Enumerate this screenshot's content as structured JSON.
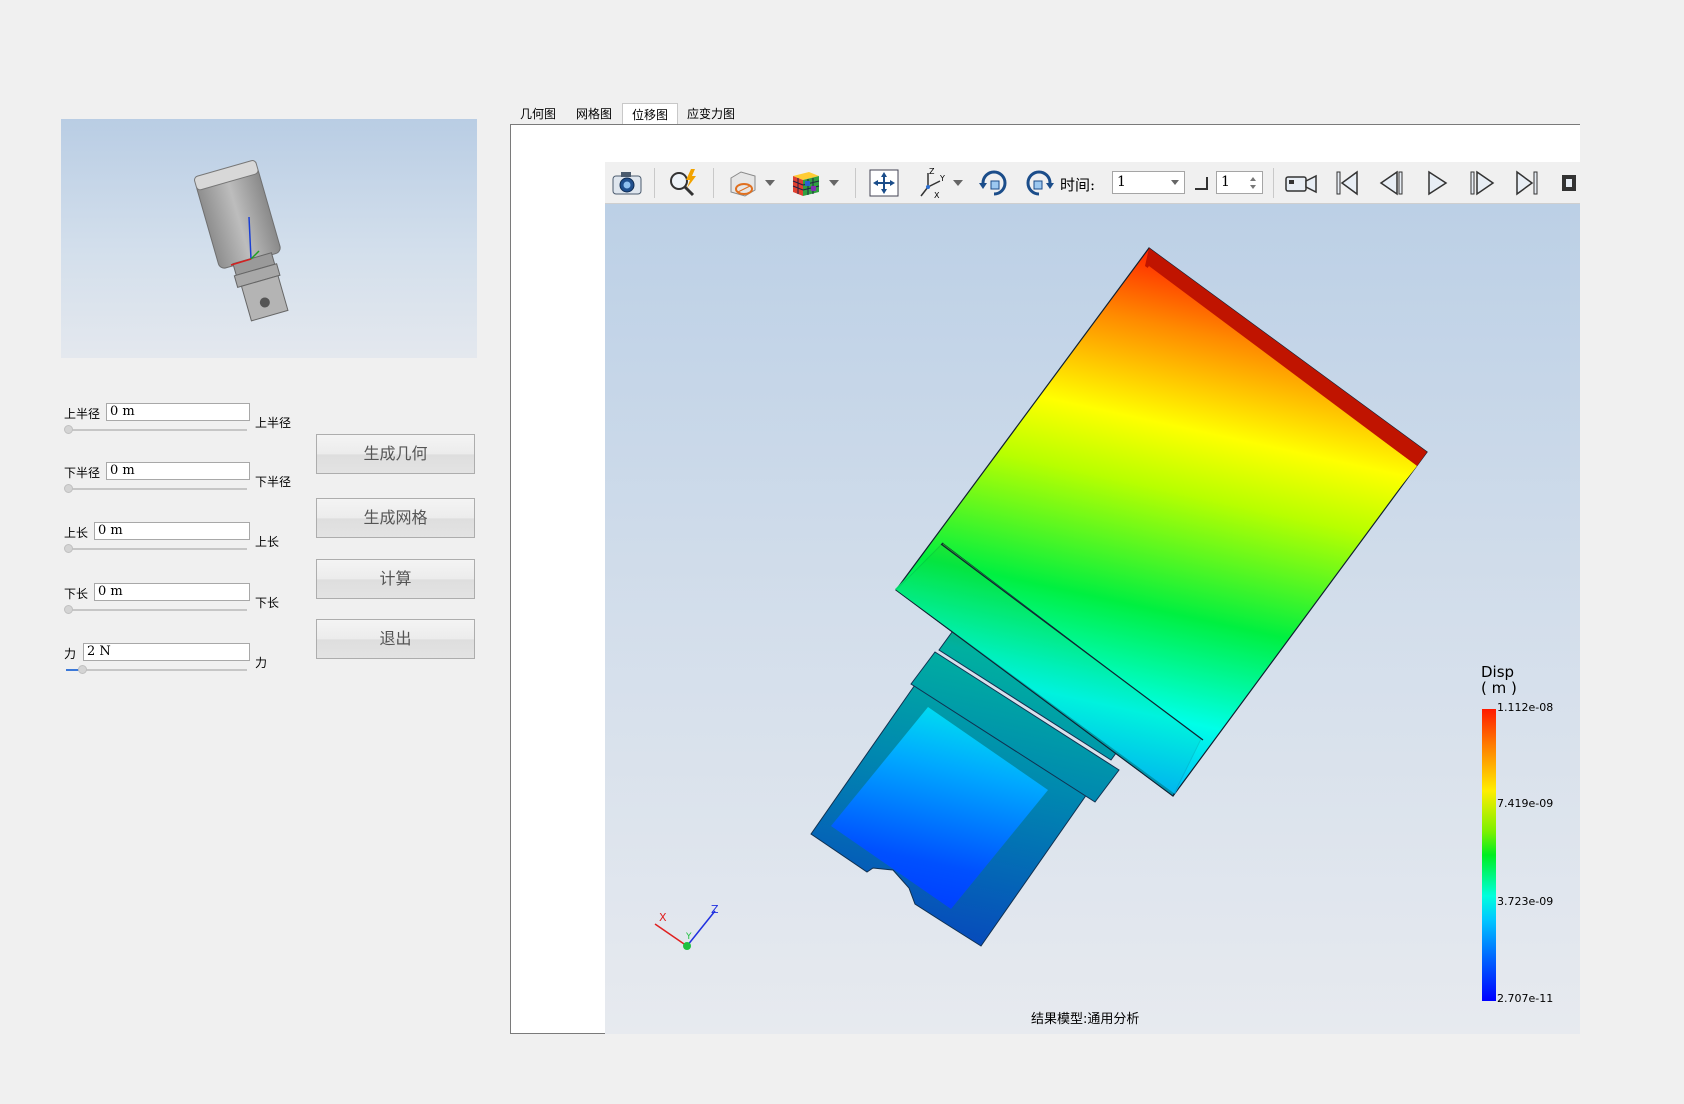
{
  "preview": {
    "name": "geometry-preview"
  },
  "params": [
    {
      "id": "upper-radius",
      "label": "上半径",
      "value": "0 m",
      "unit_label": "上半径",
      "slider": 0
    },
    {
      "id": "lower-radius",
      "label": "下半径",
      "value": "0 m",
      "unit_label": "下半径",
      "slider": 0
    },
    {
      "id": "upper-length",
      "label": "上长",
      "value": "0 m",
      "unit_label": "上长",
      "slider": 0
    },
    {
      "id": "lower-length",
      "label": "下长",
      "value": "0 m",
      "unit_label": "下长",
      "slider": 0
    },
    {
      "id": "force",
      "label": "力",
      "value": "2 N",
      "unit_label": "力",
      "slider": 0.08
    }
  ],
  "buttons": {
    "generate_geometry": "生成几何",
    "generate_mesh": "生成网格",
    "compute": "计算",
    "exit": "退出"
  },
  "tabs": [
    {
      "label": "几何图",
      "active": false
    },
    {
      "label": "网格图",
      "active": false
    },
    {
      "label": "位移图",
      "active": true
    },
    {
      "label": "应变力图",
      "active": false
    }
  ],
  "toolbar": {
    "time_label": "时间:",
    "time_value": "1",
    "step_value": "1",
    "icons": [
      "camera-icon",
      "zoom-icon",
      "display-mode-icon",
      "color-cube-icon",
      "fit-view-icon",
      "axes-icon",
      "rotate-cw-icon",
      "rotate-ccw-icon",
      "record-video-icon",
      "first-frame-icon",
      "previous-frame-icon",
      "play-icon",
      "next-frame-icon",
      "last-frame-icon"
    ]
  },
  "legend": {
    "title": "Disp",
    "unit": "( m )",
    "max": "1.112e-08",
    "mid_high": "7.419e-09",
    "mid_low": "3.723e-09",
    "min": "2.707e-11",
    "colors": [
      "#ff1a00",
      "#ffee00",
      "#00ee20",
      "#00ffdd",
      "#0000ff"
    ]
  },
  "axes_triad": {
    "x": "X",
    "y": "Y",
    "z": "Z"
  },
  "caption": "结果模型:通用分析"
}
